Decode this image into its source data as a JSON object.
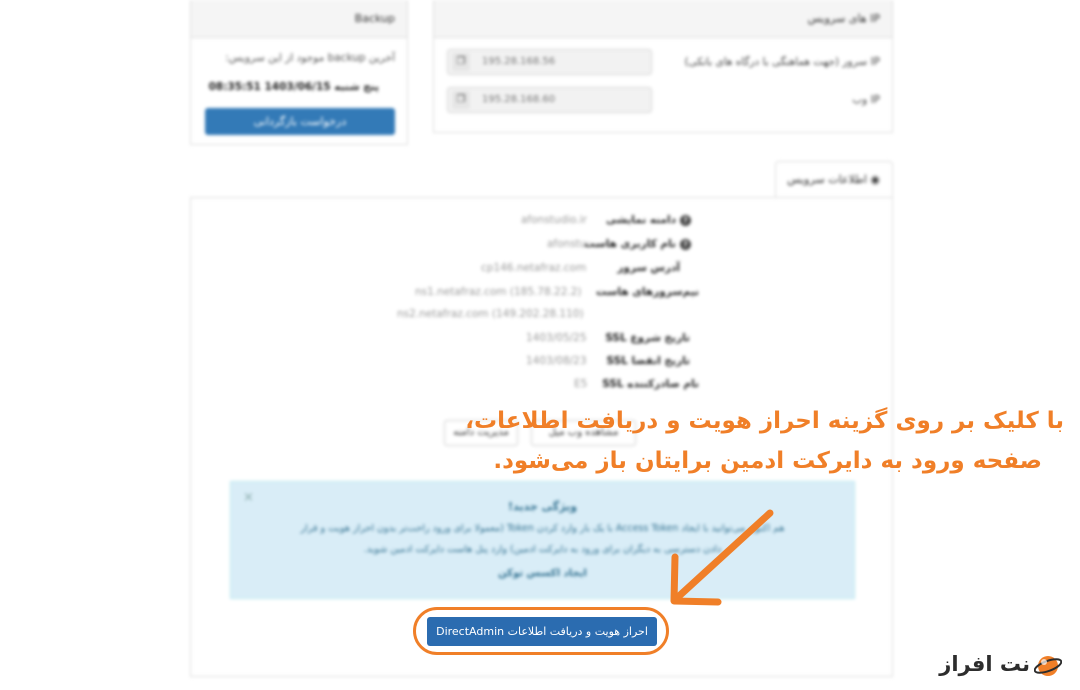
{
  "backup_panel": {
    "title": "Backup",
    "last_backup_label": "آخرین backup موجود از این سرویس:",
    "last_backup_value": "پنج شنبه 1403/06/15 08:35:51",
    "restore_button": "درخواست بازگردانی"
  },
  "service_ip_panel": {
    "title": "IP های سرویس",
    "rows": [
      {
        "label": "IP سرور (جهت هماهنگی با درگاه های بانکی)",
        "value": "195.28.168.56"
      },
      {
        "label": "IP وب",
        "value": "195.28.168.60"
      }
    ]
  },
  "tab": {
    "label": "اطلاعات سرویس"
  },
  "info_rows": [
    {
      "label": "دامنه نمایشی",
      "value": "afonstudio.ir",
      "has_icon": true
    },
    {
      "label": "نام کاربری هاست",
      "value": "afonstu",
      "has_icon": true
    },
    {
      "label": "آدرس سرور",
      "value": "cp146.netafraz.com",
      "has_icon": false
    },
    {
      "label": "نیم‌سرورهای هاست",
      "value": "ns1.netafraz.com (185.78.22.2)",
      "has_icon": false
    },
    {
      "label": "",
      "value": "ns2.netafraz.com (149.202.28.110)",
      "has_icon": false
    },
    {
      "label": "تاریخ شروع SSL",
      "value": "1403/05/25",
      "has_icon": false
    },
    {
      "label": "تاریخ انقضا SSL",
      "value": "1403/08/23",
      "has_icon": false
    },
    {
      "label": "نام صادرکننده SSL",
      "value": "E5",
      "has_icon": false
    }
  ],
  "action_buttons": {
    "manage_domain": "مدیریت دامنه",
    "webmail": "مشاهده وب میل"
  },
  "alert": {
    "title": "ویژگی جدید!",
    "line1": "هم اکنون می‌توانید با ایجاد Access Token با یک بار وارد کردن Token (معمولا برای ورود راحت‌تر بدون احراز هویت و قرار",
    "line2": "دادن دسترسی به دیگران برای ورود به دایرکت ادمین) وارد پنل هاست دایرکت ادمین شوید.",
    "link": "ایجاد اکسس توکن",
    "close": "×"
  },
  "main_button": "احراز هویت و دریافت اطلاعات DirectAdmin",
  "annotation": {
    "line1": "با کلیک بر روی گزینه احراز هویت و دریافت اطلاعات،",
    "line2": "صفحه ورود به دایرکت ادمین برایتان باز می‌شود.",
    "color": "#f07f28"
  },
  "logo": {
    "text": "نت افراز",
    "color": "#f07f28"
  }
}
